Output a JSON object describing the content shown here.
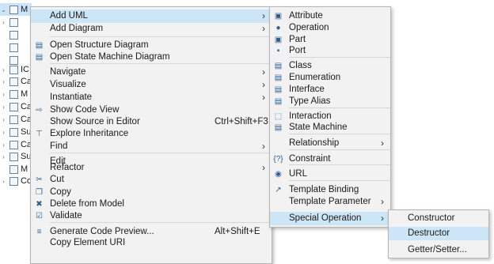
{
  "tree": [
    {
      "tw": "⌄",
      "label": "M",
      "sel": true
    },
    {
      "tw": "›",
      "label": ""
    },
    {
      "tw": "",
      "label": ""
    },
    {
      "tw": "",
      "label": ""
    },
    {
      "tw": "",
      "label": ""
    },
    {
      "tw": "›",
      "label": "IC"
    },
    {
      "tw": "›",
      "label": "Ca"
    },
    {
      "tw": "›",
      "label": "M"
    },
    {
      "tw": "›",
      "label": "Ca"
    },
    {
      "tw": "›",
      "label": "Ca"
    },
    {
      "tw": "›",
      "label": "Su"
    },
    {
      "tw": "›",
      "label": "Ca"
    },
    {
      "tw": "›",
      "label": "Su"
    },
    {
      "tw": "",
      "label": "M"
    },
    {
      "tw": "›",
      "label": "Co"
    }
  ],
  "main_menu": [
    {
      "label": "Add UML",
      "sub": true,
      "highlight": true
    },
    {
      "label": "Add Diagram",
      "sub": true
    },
    {
      "sep": true
    },
    {
      "label": "Open Structure Diagram",
      "icon": "structure-diagram-icon",
      "glyph": "▤"
    },
    {
      "label": "Open State Machine Diagram",
      "icon": "state-machine-diagram-icon",
      "glyph": "▤"
    },
    {
      "sep": true
    },
    {
      "label": "Navigate",
      "sub": true
    },
    {
      "label": "Visualize",
      "sub": true
    },
    {
      "label": "Instantiate",
      "sub": true
    },
    {
      "label": "Show Code View",
      "icon": "code-view-icon",
      "glyph": "⇨"
    },
    {
      "label": "Show Source in Editor",
      "accel": "Ctrl+Shift+F3"
    },
    {
      "label": "Explore Inheritance",
      "icon": "inheritance-icon",
      "glyph": "⊤"
    },
    {
      "label": "Find",
      "sub": true
    },
    {
      "sep": true
    },
    {
      "label": "Edit"
    },
    {
      "label": "Refactor",
      "sub": true
    },
    {
      "label": "Cut",
      "icon": "cut-icon",
      "glyph": "✂"
    },
    {
      "label": "Copy",
      "icon": "copy-icon",
      "glyph": "❐"
    },
    {
      "label": "Delete from Model",
      "icon": "delete-icon",
      "glyph": "✖"
    },
    {
      "sep": true
    },
    {
      "label": "Validate",
      "icon": "validate-icon",
      "glyph": "☑"
    },
    {
      "label": "Generate Code Preview...",
      "accel": "Alt+Shift+E",
      "icon": "code-preview-icon",
      "glyph": "≡"
    },
    {
      "label": "Copy Element URI"
    }
  ],
  "uml_menu": [
    {
      "label": "Attribute",
      "icon": "attribute-icon",
      "glyph": "▣"
    },
    {
      "label": "Operation",
      "icon": "operation-icon",
      "glyph": "●"
    },
    {
      "label": "Part",
      "icon": "part-icon",
      "glyph": "▣"
    },
    {
      "label": "Port",
      "icon": "port-icon",
      "glyph": "▪"
    },
    {
      "sep": true
    },
    {
      "label": "Class",
      "icon": "class-icon",
      "glyph": "▤"
    },
    {
      "label": "Enumeration",
      "icon": "enumeration-icon",
      "glyph": "▤"
    },
    {
      "label": "Interface",
      "icon": "interface-icon",
      "glyph": "▤"
    },
    {
      "label": "Type Alias",
      "icon": "type-alias-icon",
      "glyph": "▤"
    },
    {
      "sep": true
    },
    {
      "label": "Interaction",
      "icon": "interaction-icon",
      "glyph": "⬚"
    },
    {
      "label": "State Machine",
      "icon": "state-machine-icon",
      "glyph": "▤"
    },
    {
      "sep": true
    },
    {
      "label": "Relationship",
      "sub": true
    },
    {
      "sep": true
    },
    {
      "label": "Constraint",
      "icon": "constraint-icon",
      "glyph": "{?}"
    },
    {
      "label": "URL",
      "icon": "url-icon",
      "glyph": "◉"
    },
    {
      "sep": true
    },
    {
      "label": "Template Binding",
      "icon": "template-binding-icon",
      "glyph": "↗"
    },
    {
      "label": "Template Parameter",
      "sub": true
    },
    {
      "sep": true
    },
    {
      "label": "Special Operation",
      "sub": true,
      "highlight": true
    }
  ],
  "special_menu": [
    {
      "label": "Constructor"
    },
    {
      "label": "Destructor",
      "highlight": true
    },
    {
      "label": "Getter/Setter..."
    }
  ],
  "colors": {
    "highlight": "#cde6f7",
    "menu_bg": "#f2f2f2",
    "selected_tree": "#cde3f8"
  }
}
